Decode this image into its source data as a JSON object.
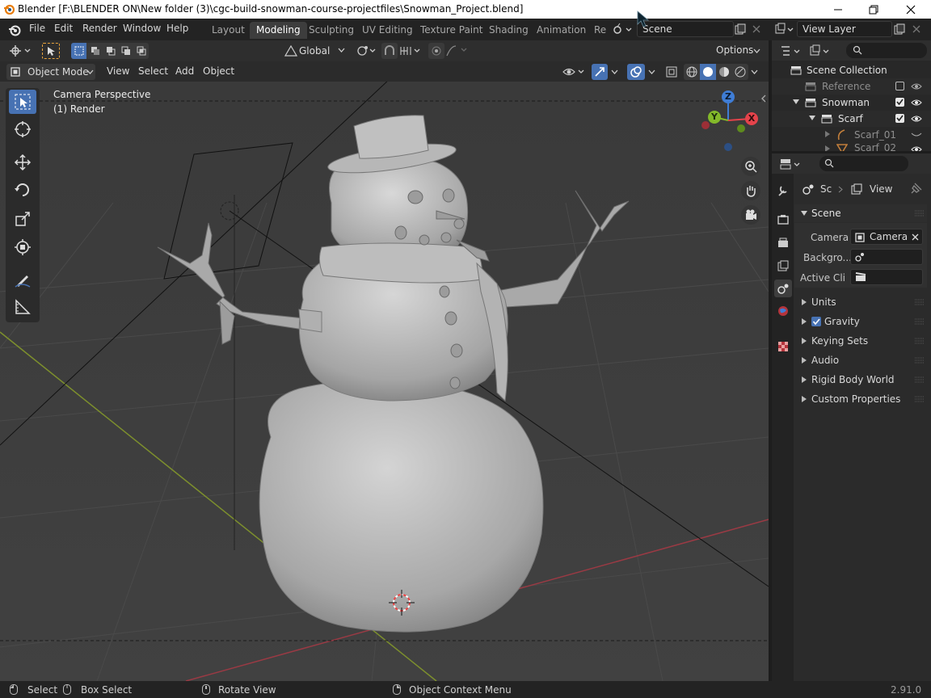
{
  "window": {
    "title": "Blender [F:\\BLENDER ON\\New folder (3)\\cgc-build-snowman-course-projectfiles\\Snowman_Project.blend]"
  },
  "menu": {
    "items": [
      "File",
      "Edit",
      "Render",
      "Window",
      "Help"
    ]
  },
  "workspaces": {
    "tabs": [
      "Layout",
      "Modeling",
      "Sculpting",
      "UV Editing",
      "Texture Paint",
      "Shading",
      "Animation",
      "Re"
    ],
    "active": "Modeling"
  },
  "scene_selector": {
    "value": "Scene"
  },
  "view_layer_selector": {
    "value": "View Layer"
  },
  "tool_header": {
    "orientation": "Global",
    "options_label": "Options"
  },
  "view_header": {
    "mode": "Object Mode",
    "menus": [
      "View",
      "Select",
      "Add",
      "Object"
    ]
  },
  "viewport": {
    "camera_label": "Camera Perspective",
    "collection_label": "(1) Render",
    "gizmo": {
      "x": "X",
      "y": "Y",
      "z": "Z"
    }
  },
  "outliner": {
    "rows": [
      {
        "label": "Scene Collection"
      },
      {
        "label": "Reference"
      },
      {
        "label": "Snowman"
      },
      {
        "label": "Scarf"
      },
      {
        "label": "Scarf_01"
      },
      {
        "label": "Scarf_02"
      }
    ]
  },
  "properties": {
    "breadcrumb_scene": "Sc",
    "breadcrumb_view": "View",
    "section_title": "Scene",
    "fields": {
      "camera_label": "Camera",
      "camera_value": "Camera",
      "background_label": "Backgro...",
      "active_clip_label": "Active Cli"
    },
    "subpanels": [
      "Units",
      "Gravity",
      "Keying Sets",
      "Audio",
      "Rigid Body World",
      "Custom Properties"
    ],
    "gravity_checked": true
  },
  "statusbar": {
    "select": "Select",
    "box_select": "Box Select",
    "rotate_view": "Rotate View",
    "context_menu": "Object Context Menu",
    "version": "2.91.0"
  },
  "colors": {
    "accent": "#4772b3",
    "x_axis": "#e5434b",
    "y_axis": "#83b92a",
    "z_axis": "#3f7dd6"
  }
}
